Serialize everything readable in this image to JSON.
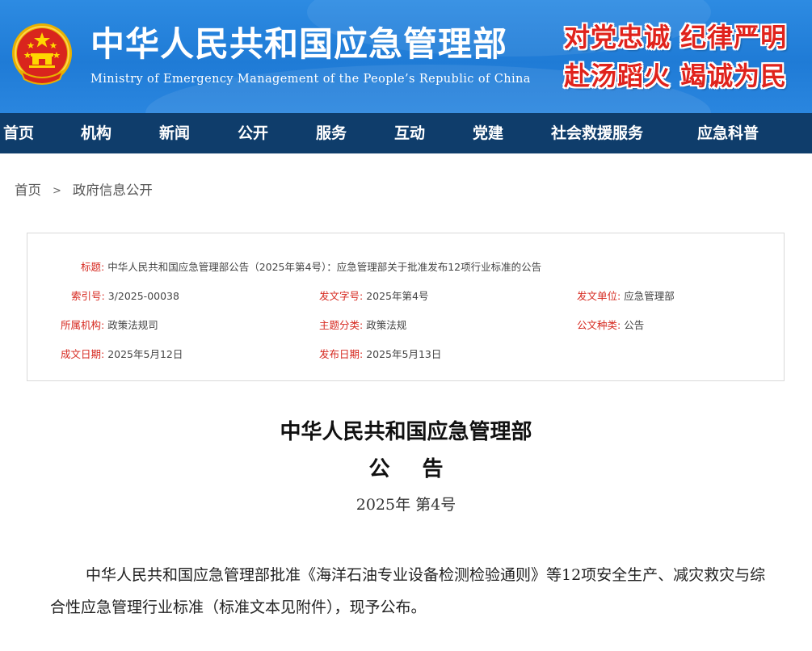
{
  "header": {
    "title": "中华人民共和国应急管理部",
    "subtitle": "Ministry of Emergency Management of the People’s Republic of China",
    "slogan_line1": "对党忠诚 纪律严明",
    "slogan_line2": "赴汤蹈火 竭诚为民",
    "colors": {
      "header_blue": "#2483de",
      "nav_navy": "#0f3d6b",
      "slogan_red": "#e0231c",
      "label_red": "#d6281f"
    },
    "emblem_icon": "national-emblem-icon"
  },
  "nav": {
    "items": [
      "首页",
      "机构",
      "新闻",
      "公开",
      "服务",
      "互动",
      "党建",
      "社会救援服务",
      "应急科普"
    ]
  },
  "breadcrumb": {
    "home": "首页",
    "separator": ">",
    "current": "政府信息公开"
  },
  "info": {
    "title_label": "标题:",
    "title_value": "中华人民共和国应急管理部公告（2025年第4号）：应急管理部关于批准发布12项行业标准的公告",
    "index_label": "索引号:",
    "index_value": "3/2025-00038",
    "docno_label": "发文字号:",
    "docno_value": "2025年第4号",
    "issuer_label": "发文单位:",
    "issuer_value": "应急管理部",
    "org_label": "所属机构:",
    "org_value": "政策法规司",
    "topic_label": "主题分类:",
    "topic_value": "政策法规",
    "kind_label": "公文种类:",
    "kind_value": "公告",
    "created_label": "成文日期:",
    "created_value": "2025年5月12日",
    "published_label": "发布日期:",
    "published_value": "2025年5月13日"
  },
  "document": {
    "title_line1": "中华人民共和国应急管理部",
    "title_line2": "公告",
    "number": "2025年 第4号",
    "body": "中华人民共和国应急管理部批准《海洋石油专业设备检测检验通则》等12项安全生产、减灾救灾与综合性应急管理行业标准（标准文本见附件），现予公布。"
  }
}
